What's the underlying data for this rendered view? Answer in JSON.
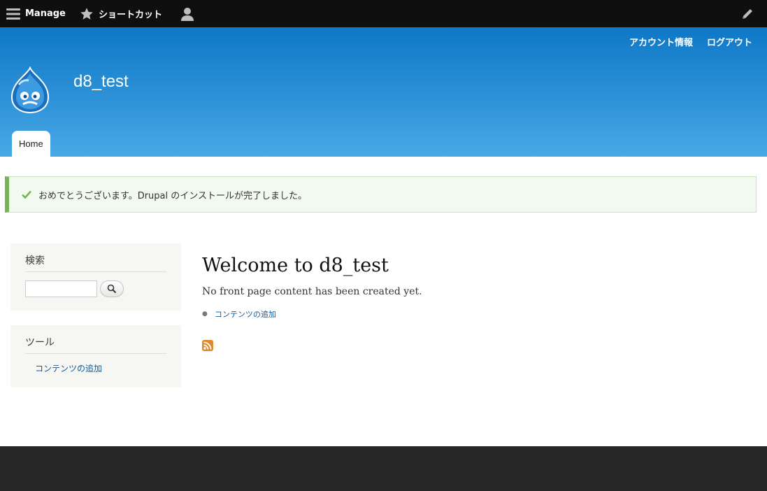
{
  "toolbar": {
    "manage_label": "Manage",
    "shortcuts_label": "ショートカット",
    "user_icon": "user-icon",
    "edit_icon": "pencil-icon"
  },
  "header": {
    "account_link": "アカウント情報",
    "logout_link": "ログアウト",
    "site_name": "d8_test",
    "logo_icon": "drupal-logo",
    "tabs": [
      {
        "label": "Home"
      }
    ]
  },
  "status": {
    "message": "おめでとうございます。Drupal のインストールが完了しました。",
    "icon": "check-icon"
  },
  "sidebar": {
    "search": {
      "title": "検索",
      "input_value": "",
      "button_icon": "search-icon"
    },
    "tools": {
      "title": "ツール",
      "links": [
        {
          "label": "コンテンツの追加"
        }
      ]
    }
  },
  "main": {
    "title": "Welcome to d8_test",
    "intro": "No front page content has been created yet.",
    "links": [
      {
        "label": "コンテンツの追加"
      }
    ],
    "feed_icon": "rss-icon"
  },
  "colors": {
    "toolbar_bg": "#0f0f0f",
    "header_top": "#0e78c6",
    "header_bottom": "#48a9e6",
    "status_border": "#77b259",
    "link": "#0c5a9e",
    "footer_bg": "#262626"
  }
}
